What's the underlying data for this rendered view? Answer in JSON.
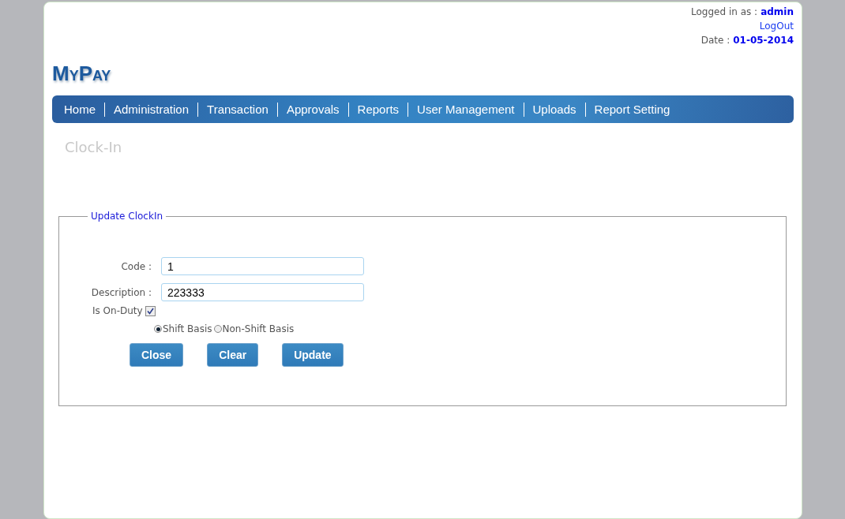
{
  "header": {
    "login_label": "Logged in as :",
    "login_user": "admin",
    "logout_link": "LogOut",
    "date_label": "Date :",
    "date_value": "01-05-2014"
  },
  "logo": "MyPay",
  "nav": [
    {
      "label": "Home"
    },
    {
      "label": "Administration"
    },
    {
      "label": "Transaction"
    },
    {
      "label": "Approvals"
    },
    {
      "label": "Reports"
    },
    {
      "label": "User Management"
    },
    {
      "label": "Uploads"
    },
    {
      "label": "Report Setting"
    }
  ],
  "page_title": "Clock-In",
  "form": {
    "legend": "Update ClockIn",
    "fields": [
      {
        "label": "Code :",
        "value": "1"
      },
      {
        "label": "Description :",
        "value": "223333"
      }
    ],
    "on_duty": {
      "label": "Is On-Duty",
      "checked": true
    },
    "basis": [
      {
        "label": "Shift Basis",
        "selected": true
      },
      {
        "label": "Non-Shift Basis",
        "selected": false
      }
    ],
    "buttons": [
      "Close",
      "Clear",
      "Update"
    ]
  }
}
